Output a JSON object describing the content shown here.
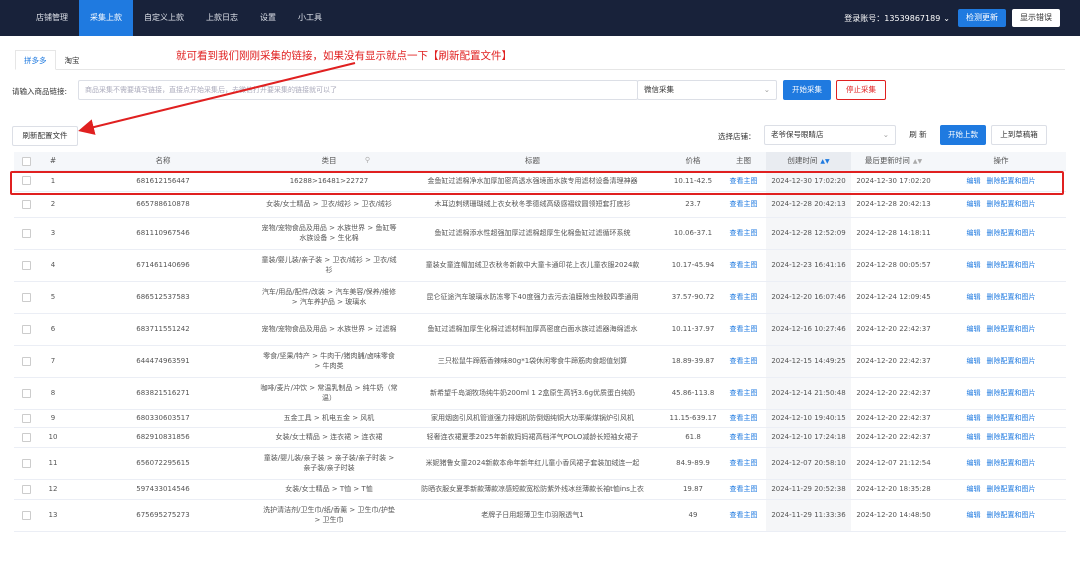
{
  "nav": {
    "items": [
      "店铺管理",
      "采集上款",
      "自定义上款",
      "上款日志",
      "设置",
      "小工具"
    ],
    "active_index": 1
  },
  "account": {
    "label": "登录账号：13539867189",
    "chevron_icon": "chevron-down-icon"
  },
  "header_buttons": {
    "check_update": "检测更新",
    "show_log": "显示错误"
  },
  "platform_tabs": [
    "拼多多",
    "淘宝"
  ],
  "platform_tab_active": 0,
  "annotation": "就可看到我们刚刚采集的链接，如果没有显示就点一下【刷新配置文件】",
  "collect": {
    "label": "请输入商品链接:",
    "input_placeholder": "商品采集不需要填写链接，直接点开始采集后，去微信打开要采集的链接就可以了",
    "mode": "微信采集",
    "start_button": "开始采集",
    "stop_button": "停止采集"
  },
  "refresh_config_button": "刷新配置文件",
  "store": {
    "label": "选择店铺：",
    "selected": "老爷保号眼睛店",
    "refresh_button": "刷 新",
    "start_upload_button": "开始上款",
    "upload_draft_button": "上到草稿箱"
  },
  "table": {
    "headers": [
      "",
      "#",
      "名称",
      "类目",
      "标题",
      "价格",
      "主图",
      "创建时间",
      "最后更新时间",
      "操作"
    ],
    "view_image_label": "查看主图",
    "edit_label": "编辑",
    "delete_label": "删除配置和图片",
    "rows": [
      {
        "no": "1",
        "name": "681612156447",
        "category": "16288>16481>22727",
        "title": "金鱼缸过滤棉净水加厚加密高透水强境面水族专用滤材设备清理神器",
        "price": "10.11-42.5",
        "created": "2024-12-30 17:02:20",
        "updated": "2024-12-30 17:02:20"
      },
      {
        "no": "2",
        "name": "665788610878",
        "category": "女装/女士精品 > 卫衣/绒衫 > 卫衣/绒衫",
        "title": "木耳边刺绣珊瑚绒上衣女秋冬季德绒高级感褶纹圆领短套打底衫",
        "price": "23.7",
        "created": "2024-12-28 20:42:13",
        "updated": "2024-12-28 20:42:13"
      },
      {
        "no": "3",
        "name": "681110967546",
        "category": "宠物/宠物食品及用品 > 水族世界 > 鱼缸等水族设备 > 生化棉",
        "title": "鱼缸过滤棉添水性超强加厚过滤棉超厚生化棉鱼缸过滤循环系统",
        "price": "10.06-37.1",
        "created": "2024-12-28 12:52:09",
        "updated": "2024-12-28 14:18:11"
      },
      {
        "no": "4",
        "name": "671461140696",
        "category": "童装/婴儿装/亲子装 > 卫衣/绒衫 > 卫衣/绒衫",
        "title": "童装女童连帽加绒卫衣秋冬新款中大童卡通印花上衣儿童衣服2024款",
        "price": "10.17-45.94",
        "created": "2024-12-23 16:41:16",
        "updated": "2024-12-28 00:05:57"
      },
      {
        "no": "5",
        "name": "686512537583",
        "category": "汽车/用品/配件/改装 > 汽车美容/保养/维修 > 汽车养护品 > 玻璃水",
        "title": "昆仑征途汽车玻璃水防冻零下40度强力去污去油膜除虫除胶四季通用",
        "price": "37.57-90.72",
        "created": "2024-12-20 16:07:46",
        "updated": "2024-12-24 12:09:45"
      },
      {
        "no": "6",
        "name": "683711551242",
        "category": "宠物/宠物食品及用品 > 水族世界 > 过滤棉",
        "title": "鱼缸过滤棉加厚生化棉过滤材料加厚高密度白面水族过滤器海绵滤水",
        "price": "10.11-37.97",
        "created": "2024-12-16 10:27:46",
        "updated": "2024-12-20 22:42:37"
      },
      {
        "no": "7",
        "name": "644474963591",
        "category": "零食/坚果/特产 > 牛肉干/猪肉脯/卤味零食 > 牛肉类",
        "title": "三只松鼠牛蹄筋香辣味80g*1袋休闲零食牛蹄筋肉食超值划算",
        "price": "18.89-39.87",
        "created": "2024-12-15 14:49:25",
        "updated": "2024-12-20 22:42:37"
      },
      {
        "no": "8",
        "name": "683821516271",
        "category": "咖啡/麦片/冲饮 > 常温乳制品 > 纯牛奶（常温）",
        "title": "新希望千岛湖牧场纯牛奶200ml 1 2盒原生高钙3.6g优质蛋白纯奶",
        "price": "45.86-113.8",
        "created": "2024-12-14 21:50:48",
        "updated": "2024-12-20 22:42:37"
      },
      {
        "no": "9",
        "name": "680330603517",
        "category": "五金工具 > 机电五金 > 风机",
        "title": "家用烟囱引风机管道强力排烟机防倒烟纯铜大功率柴煤锅炉引风机",
        "price": "11.15-639.17",
        "created": "2024-12-10 19:40:15",
        "updated": "2024-12-20 22:42:37"
      },
      {
        "no": "10",
        "name": "682910831856",
        "category": "女装/女士精品 > 连衣裙 > 连衣裙",
        "title": "轻奢连衣裙夏季2025年新款妈妈裙高档洋气POLO减龄长短袖女裙子",
        "price": "61.8",
        "created": "2024-12-10 17:24:18",
        "updated": "2024-12-20 22:42:37"
      },
      {
        "no": "11",
        "name": "656072295615",
        "category": "童装/婴儿装/亲子装 > 亲子装/亲子时装 > 亲子装/亲子时装",
        "title": "米妮猪鲁女童2024新款本命年新年红儿童小香风裙子套装加绒连一起",
        "price": "84.9-89.9",
        "created": "2024-12-07 20:58:10",
        "updated": "2024-12-07 21:12:54"
      },
      {
        "no": "12",
        "name": "597433014546",
        "category": "女装/女士精品 > T恤 > T恤",
        "title": "防晒衣服女夏季新款薄款凉感短款宽松防紫外线冰丝薄款长袖t恤ins上衣",
        "price": "19.87",
        "created": "2024-11-29 20:52:38",
        "updated": "2024-12-20 18:35:28"
      },
      {
        "no": "13",
        "name": "675695275273",
        "category": "洗护清洁剂/卫生巾/纸/香薰 > 卫生巾/护垫 > 卫生巾",
        "title": "老牌子日用超薄卫生巾羽限透气1",
        "price": "49",
        "created": "2024-11-29 11:33:36",
        "updated": "2024-12-20 14:48:50"
      }
    ]
  }
}
